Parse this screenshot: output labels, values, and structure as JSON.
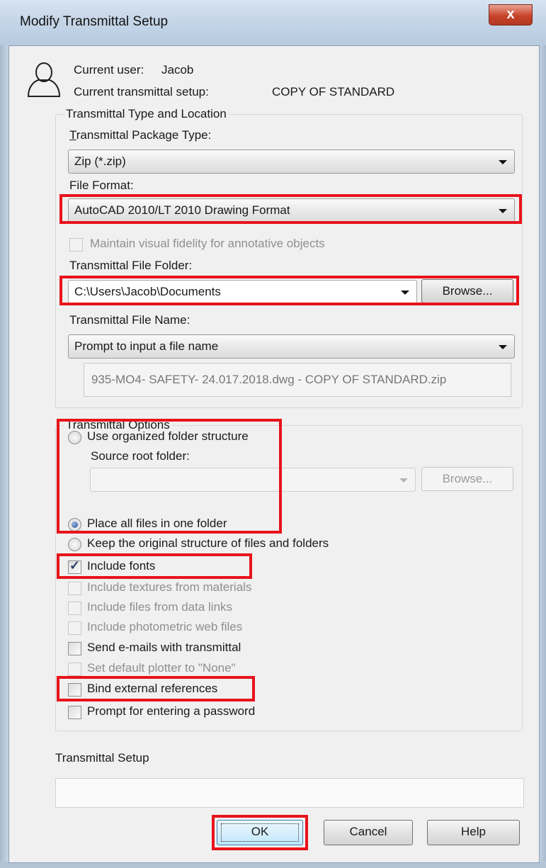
{
  "window": {
    "title": "Modify Transmittal Setup",
    "close_label": "x"
  },
  "info": {
    "current_user_label": "Current user:",
    "current_user": "Jacob",
    "current_setup_label": "Current transmittal setup:",
    "current_setup": "COPY OF STANDARD"
  },
  "type_location": {
    "group_title": "Transmittal Type and Location",
    "package_type_label": "Transmittal Package Type:",
    "package_type_value": "Zip (*.zip)",
    "file_format_label": "File Format:",
    "file_format_value": "AutoCAD 2010/LT 2010 Drawing Format",
    "maintain_fidelity_label": "Maintain visual fidelity for annotative objects",
    "folder_label": "Transmittal File Folder:",
    "folder_value": "C:\\Users\\Jacob\\Documents",
    "browse_label": "Browse...",
    "file_name_label": "Transmittal File Name:",
    "file_name_value": "Prompt to input a file name",
    "file_name_preview": "935-MO4- SAFETY- 24.017.2018.dwg - COPY OF STANDARD.zip"
  },
  "options": {
    "group_title": "Transmittal Options",
    "organized_label": "Use organized folder structure",
    "source_root_label": "Source root folder:",
    "source_root_value": "",
    "browse_label": "Browse...",
    "place_all_label": "Place all files in one folder",
    "keep_original_label": "Keep the original structure of files and folders",
    "include_fonts_label": "Include fonts",
    "include_textures_label": "Include textures from materials",
    "include_data_links_label": "Include files from data links",
    "include_photometric_label": "Include photometric web files",
    "send_emails_label": "Send e-mails with transmittal",
    "set_plotter_label": "Set default plotter to \"None\"",
    "bind_xrefs_label": "Bind external references",
    "prompt_password_label": "Prompt for entering a password",
    "selected_radio": "Place all files in one folder",
    "include_fonts_checked": true
  },
  "setup": {
    "label": "Transmittal Setup",
    "value": ""
  },
  "buttons": {
    "ok": "OK",
    "cancel": "Cancel",
    "help": "Help"
  },
  "colors": {
    "highlight": "#e8131b",
    "dialog_bg": "#f0f0f0",
    "titlebar": "#c5d6e8",
    "close_button": "#c8432b"
  }
}
